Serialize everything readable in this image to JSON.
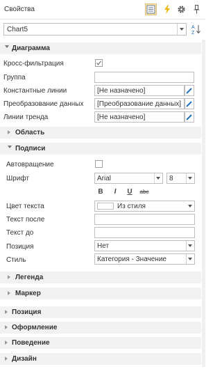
{
  "header": {
    "title": "Свойства",
    "icons": [
      "properties-icon",
      "events-bolt-icon",
      "gear-icon",
      "pin-icon"
    ]
  },
  "selector": {
    "value": "Chart5"
  },
  "sections": {
    "diagram": "Диаграмма",
    "area": "Область",
    "labels": "Подписи",
    "legend": "Легенда",
    "marker": "Маркер",
    "position": "Позиция",
    "appearance": "Оформление",
    "behavior": "Поведение",
    "design": "Дизайн"
  },
  "diagram": {
    "cross_filter_label": "Кросс-фильтрация",
    "cross_filter_checked": true,
    "group_label": "Группа",
    "group_value": "",
    "const_lines_label": "Константные линии",
    "const_lines_value": "[Не назначено]",
    "transform_label": "Преобразование данных",
    "transform_value": "[Преобразование данных]",
    "trend_label": "Линии тренда",
    "trend_value": "[Не назначено]"
  },
  "labels": {
    "autorotate_label": "Автовращение",
    "autorotate_checked": false,
    "font_label": "Шрифт",
    "font_name": "Arial",
    "font_size": "8",
    "format_buttons": [
      "B",
      "I",
      "U",
      "abc"
    ],
    "text_color_label": "Цвет текста",
    "text_color_value": "Из стиля",
    "text_after_label": "Текст после",
    "text_after_value": "",
    "text_before_label": "Текст до",
    "text_before_value": "",
    "position_label": "Позиция",
    "position_value": "Нет",
    "style_label": "Стиль",
    "style_value": "Категория - Значение"
  },
  "colors": {
    "accent": "#1f6fbf",
    "bolt": "#f2b705",
    "section_bg": "#f2f2f2"
  }
}
